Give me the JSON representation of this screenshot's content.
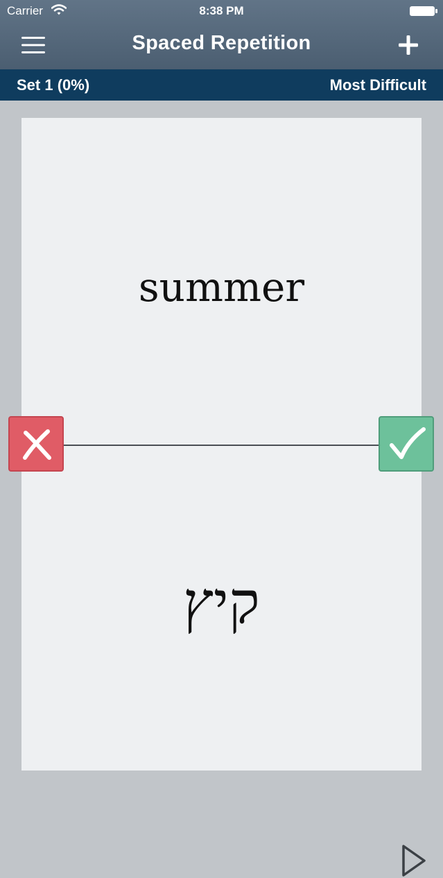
{
  "status_bar": {
    "carrier": "Carrier",
    "time": "8:38 PM"
  },
  "nav": {
    "title": "Spaced Repetition",
    "menu_icon": "hamburger-menu-icon",
    "add_icon": "plus-icon"
  },
  "subheader": {
    "set_label": "Set 1 (0%)",
    "mode_label": "Most Difficult"
  },
  "card": {
    "front": "summer",
    "back": "קיץ"
  },
  "actions": {
    "wrong_icon": "x-mark-icon",
    "right_icon": "checkmark-icon",
    "play_icon": "play-icon"
  },
  "colors": {
    "nav_bg": "#566a7d",
    "subheader_bg": "#0f3c5e",
    "page_bg": "#c1c5c9",
    "card_bg": "#eef0f2",
    "wrong": "#e05c66",
    "right": "#6dc19b"
  }
}
